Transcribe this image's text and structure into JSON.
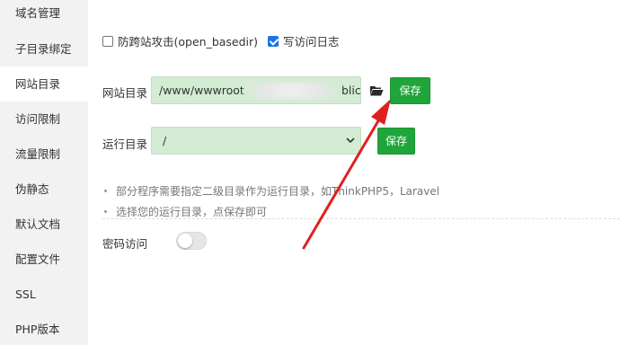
{
  "sidebar": {
    "items": [
      {
        "label": "域名管理"
      },
      {
        "label": "子目录绑定"
      },
      {
        "label": "网站目录"
      },
      {
        "label": "访问限制"
      },
      {
        "label": "流量限制"
      },
      {
        "label": "伪静态"
      },
      {
        "label": "默认文档"
      },
      {
        "label": "配置文件"
      },
      {
        "label": "SSL"
      },
      {
        "label": "PHP版本"
      }
    ],
    "active_index": 2
  },
  "options": {
    "anti_xss_label": "防跨站攻击(open_basedir)",
    "anti_xss_checked": false,
    "write_log_label": "写访问日志",
    "write_log_checked": true
  },
  "site_dir": {
    "label": "网站目录",
    "value_start": "/www/wwwroot",
    "value_end": "blic",
    "folder_icon": "folder-open-icon",
    "save_label": "保存"
  },
  "run_dir": {
    "label": "运行目录",
    "selected": "/",
    "save_label": "保存"
  },
  "tips": [
    "部分程序需要指定二级目录作为运行目录，如ThinkPHP5，Laravel",
    "选择您的运行目录，点保存即可"
  ],
  "password_access": {
    "label": "密码访问",
    "enabled": false
  },
  "colors": {
    "accent_green": "#20a53a",
    "input_bg": "#d3ecd3",
    "annotation_arrow": "#e02020"
  }
}
